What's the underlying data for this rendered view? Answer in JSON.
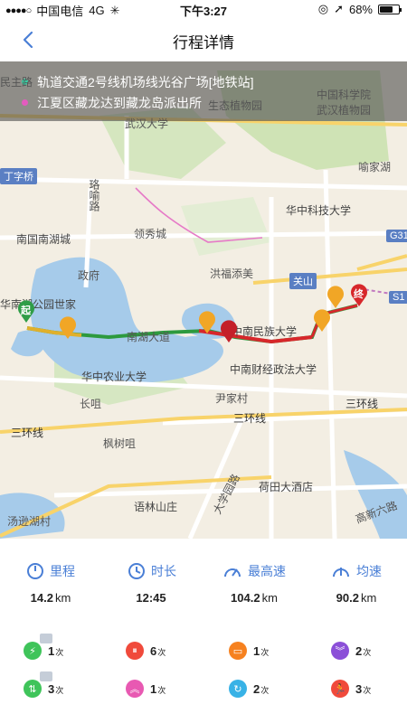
{
  "status_bar": {
    "carrier": "中国电信",
    "network": "4G",
    "time": "下午3:27",
    "battery": "68%",
    "battery_level": 0.68
  },
  "nav": {
    "title": "行程详情"
  },
  "route": {
    "start": "轨道交通2号线机场线光谷广场[地铁站]",
    "end": "江夏区藏龙达到藏龙岛派出所",
    "start_color": "#37d3a6",
    "end_color": "#e45bbf"
  },
  "map": {
    "labels": {
      "minzhu_road": "民主路",
      "wuhan_botanical": "中国科学院\n武汉植物园",
      "ecological_garden": "生态植物园",
      "wuhan_university": "武汉大学",
      "yujiatou": "喻家湖",
      "dingziqiao": "丁字桥",
      "luoshi_road": "珞喻路",
      "hust": "华中科技大学",
      "nanhu_mall": "南国南湖城",
      "lingxiu_city": "领秀城",
      "g316": "G316",
      "zhengfu": "政府",
      "hongshan_tiangmei": "洪福添美",
      "guanshan": "关山",
      "nanhu_park": "华南湖公园世家",
      "minzu_univ": "中南民族大学",
      "nanhu_ave": "南湖大道",
      "hzau": "华中农业大学",
      "zuel": "中南财经政法大学",
      "changjue": "长咀",
      "yinjiacun": "尹家村",
      "third_ring_left": "三环线",
      "third_ring_mid": "三环线",
      "third_ring_right": "三环线",
      "fengshu_zui": "枫树咀",
      "hotel": "荷田大酒店",
      "university_road": "大学园路",
      "yulin_village": "语林山庄",
      "tangxun_lake": "汤逊湖村",
      "gaoxin_6th": "高新六路",
      "s1": "S1"
    },
    "start_marker": "起",
    "end_marker": "终"
  },
  "metrics": [
    {
      "icon": "distance-icon",
      "label": "里程",
      "value": "14.2",
      "unit": "km"
    },
    {
      "icon": "duration-icon",
      "label": "时长",
      "value": "12:45",
      "unit": ""
    },
    {
      "icon": "top-speed-icon",
      "label": "最高速",
      "value": "104.2",
      "unit": "km"
    },
    {
      "icon": "avg-speed-icon",
      "label": "均速",
      "value": "90.2",
      "unit": "km"
    }
  ],
  "events": [
    {
      "name": "rapid-acceleration",
      "count": "1",
      "unit": "次",
      "color": "#3fc45a",
      "icon": "lightning-icon"
    },
    {
      "name": "sharp-braking",
      "count": "6",
      "unit": "次",
      "color": "#f04a3b",
      "icon": "brake-icon"
    },
    {
      "name": "collision",
      "count": "1",
      "unit": "次",
      "color": "#f6811f",
      "icon": "car-icon"
    },
    {
      "name": "rapid-descent",
      "count": "2",
      "unit": "次",
      "color": "#8b4fd8",
      "icon": "descend-icon"
    },
    {
      "name": "lane-change",
      "count": "3",
      "unit": "次",
      "color": "#3fc45a",
      "icon": "lane-change-icon"
    },
    {
      "name": "rapid-turn",
      "count": "1",
      "unit": "次",
      "color": "#e859b2",
      "icon": "ascend-icon"
    },
    {
      "name": "sharp-turn",
      "count": "2",
      "unit": "次",
      "color": "#38b2e6",
      "icon": "turn-icon"
    },
    {
      "name": "speeding",
      "count": "3",
      "unit": "次",
      "color": "#f04a3b",
      "icon": "runner-icon"
    }
  ]
}
